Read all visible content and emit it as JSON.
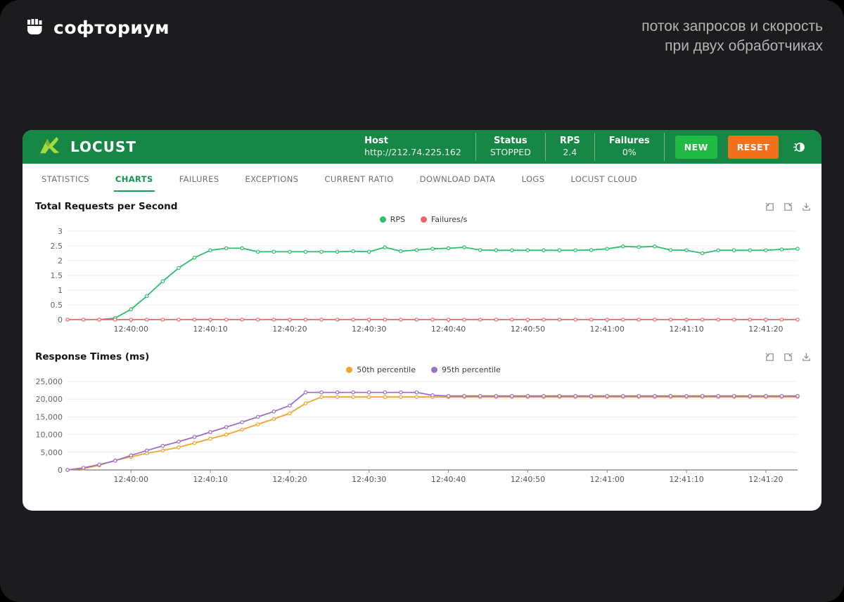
{
  "frame": {
    "brand": "софториум",
    "caption_line1": "поток запросов и скорость",
    "caption_line2": "при двух обработчиках"
  },
  "header": {
    "app_name": "LOCUST",
    "host_label": "Host",
    "host_value": "http://212.74.225.162",
    "status_label": "Status",
    "status_value": "STOPPED",
    "rps_label": "RPS",
    "rps_value": "2.4",
    "failures_label": "Failures",
    "failures_value": "0%",
    "new_button": "NEW",
    "reset_button": "RESET",
    "colors": {
      "header_bg": "#168744",
      "new_button": "#21ba45",
      "reset_button": "#f2711c",
      "logo_green": "#a6d93c"
    }
  },
  "tabs": [
    {
      "label": "STATISTICS",
      "active": false
    },
    {
      "label": "CHARTS",
      "active": true
    },
    {
      "label": "FAILURES",
      "active": false
    },
    {
      "label": "EXCEPTIONS",
      "active": false
    },
    {
      "label": "CURRENT RATIO",
      "active": false
    },
    {
      "label": "DOWNLOAD DATA",
      "active": false
    },
    {
      "label": "LOGS",
      "active": false
    },
    {
      "label": "LOCUST CLOUD",
      "active": false
    }
  ],
  "chart_data": [
    {
      "type": "line",
      "title": "Total Requests per Second",
      "xlabel": "",
      "ylabel": "",
      "x_start_time": "12:39:52",
      "t_range": [
        0,
        92
      ],
      "ylim": [
        0,
        3
      ],
      "grid": true,
      "legend_position": "top-center",
      "y_ticks": [
        {
          "v": 0,
          "label": "0"
        },
        {
          "v": 0.5,
          "label": "0.5"
        },
        {
          "v": 1,
          "label": "1"
        },
        {
          "v": 1.5,
          "label": "1.5"
        },
        {
          "v": 2,
          "label": "2"
        },
        {
          "v": 2.5,
          "label": "2.5"
        },
        {
          "v": 3,
          "label": "3"
        }
      ],
      "x_ticks": [
        {
          "t": 8,
          "label": "12:40:00"
        },
        {
          "t": 18,
          "label": "12:40:10"
        },
        {
          "t": 28,
          "label": "12:40:20"
        },
        {
          "t": 38,
          "label": "12:40:30"
        },
        {
          "t": 48,
          "label": "12:40:40"
        },
        {
          "t": 58,
          "label": "12:40:50"
        },
        {
          "t": 68,
          "label": "12:41:00"
        },
        {
          "t": 78,
          "label": "12:41:10"
        },
        {
          "t": 88,
          "label": "12:41:20"
        }
      ],
      "series": [
        {
          "name": "RPS",
          "color": "#2dbd6e",
          "points": [
            [
              4,
              0
            ],
            [
              6,
              0.05
            ],
            [
              8,
              0.35
            ],
            [
              10,
              0.8
            ],
            [
              12,
              1.3
            ],
            [
              14,
              1.75
            ],
            [
              16,
              2.1
            ],
            [
              18,
              2.35
            ],
            [
              20,
              2.42
            ],
            [
              22,
              2.42
            ],
            [
              24,
              2.3
            ],
            [
              26,
              2.3
            ],
            [
              28,
              2.3
            ],
            [
              30,
              2.3
            ],
            [
              32,
              2.3
            ],
            [
              34,
              2.3
            ],
            [
              36,
              2.32
            ],
            [
              38,
              2.3
            ],
            [
              40,
              2.45
            ],
            [
              42,
              2.32
            ],
            [
              44,
              2.36
            ],
            [
              46,
              2.4
            ],
            [
              48,
              2.42
            ],
            [
              50,
              2.45
            ],
            [
              52,
              2.36
            ],
            [
              54,
              2.35
            ],
            [
              56,
              2.35
            ],
            [
              58,
              2.35
            ],
            [
              60,
              2.35
            ],
            [
              62,
              2.35
            ],
            [
              64,
              2.35
            ],
            [
              66,
              2.36
            ],
            [
              68,
              2.4
            ],
            [
              70,
              2.48
            ],
            [
              72,
              2.46
            ],
            [
              74,
              2.48
            ],
            [
              76,
              2.36
            ],
            [
              78,
              2.35
            ],
            [
              80,
              2.25
            ],
            [
              82,
              2.35
            ],
            [
              84,
              2.35
            ],
            [
              86,
              2.35
            ],
            [
              88,
              2.35
            ],
            [
              90,
              2.38
            ],
            [
              92,
              2.4
            ]
          ]
        },
        {
          "name": "Failures/s",
          "color": "#ee6666",
          "points": [
            [
              0,
              0
            ],
            [
              2,
              0
            ],
            [
              4,
              0
            ],
            [
              6,
              0
            ],
            [
              8,
              0
            ],
            [
              10,
              0
            ],
            [
              12,
              0
            ],
            [
              14,
              0
            ],
            [
              16,
              0
            ],
            [
              18,
              0
            ],
            [
              20,
              0
            ],
            [
              22,
              0
            ],
            [
              24,
              0
            ],
            [
              26,
              0
            ],
            [
              28,
              0
            ],
            [
              30,
              0
            ],
            [
              32,
              0
            ],
            [
              34,
              0
            ],
            [
              36,
              0
            ],
            [
              38,
              0
            ],
            [
              40,
              0
            ],
            [
              42,
              0
            ],
            [
              44,
              0
            ],
            [
              46,
              0
            ],
            [
              48,
              0
            ],
            [
              50,
              0
            ],
            [
              52,
              0
            ],
            [
              54,
              0
            ],
            [
              56,
              0
            ],
            [
              58,
              0
            ],
            [
              60,
              0
            ],
            [
              62,
              0
            ],
            [
              64,
              0
            ],
            [
              66,
              0
            ],
            [
              68,
              0
            ],
            [
              70,
              0
            ],
            [
              72,
              0
            ],
            [
              74,
              0
            ],
            [
              76,
              0
            ],
            [
              78,
              0
            ],
            [
              80,
              0
            ],
            [
              82,
              0
            ],
            [
              84,
              0
            ],
            [
              86,
              0
            ],
            [
              88,
              0
            ],
            [
              90,
              0
            ],
            [
              92,
              0
            ]
          ]
        }
      ]
    },
    {
      "type": "line",
      "title": "Response Times (ms)",
      "xlabel": "",
      "ylabel": "",
      "x_start_time": "12:39:52",
      "t_range": [
        0,
        92
      ],
      "ylim": [
        0,
        25000
      ],
      "grid": true,
      "legend_position": "top-center",
      "y_ticks": [
        {
          "v": 0,
          "label": "0"
        },
        {
          "v": 5000,
          "label": "5,000"
        },
        {
          "v": 10000,
          "label": "10,000"
        },
        {
          "v": 15000,
          "label": "15,000"
        },
        {
          "v": 20000,
          "label": "20,000"
        },
        {
          "v": 25000,
          "label": "25,000"
        }
      ],
      "x_ticks": [
        {
          "t": 8,
          "label": "12:40:00"
        },
        {
          "t": 18,
          "label": "12:40:10"
        },
        {
          "t": 28,
          "label": "12:40:20"
        },
        {
          "t": 38,
          "label": "12:40:30"
        },
        {
          "t": 48,
          "label": "12:40:40"
        },
        {
          "t": 58,
          "label": "12:40:50"
        },
        {
          "t": 68,
          "label": "12:41:00"
        },
        {
          "t": 78,
          "label": "12:41:10"
        },
        {
          "t": 88,
          "label": "12:41:20"
        }
      ],
      "series": [
        {
          "name": "50th percentile",
          "color": "#f2a32c",
          "points": [
            [
              0,
              0
            ],
            [
              2,
              400
            ],
            [
              4,
              1300
            ],
            [
              6,
              2700
            ],
            [
              8,
              3700
            ],
            [
              10,
              4700
            ],
            [
              12,
              5500
            ],
            [
              14,
              6400
            ],
            [
              16,
              7600
            ],
            [
              18,
              8800
            ],
            [
              20,
              10000
            ],
            [
              22,
              11400
            ],
            [
              24,
              12900
            ],
            [
              26,
              14400
            ],
            [
              28,
              16000
            ],
            [
              30,
              18800
            ],
            [
              32,
              20600
            ],
            [
              34,
              20600
            ],
            [
              36,
              20600
            ],
            [
              38,
              20600
            ],
            [
              40,
              20600
            ],
            [
              42,
              20600
            ],
            [
              44,
              20600
            ],
            [
              46,
              20600
            ],
            [
              48,
              20600
            ],
            [
              50,
              20600
            ],
            [
              52,
              20600
            ],
            [
              54,
              20600
            ],
            [
              56,
              20600
            ],
            [
              58,
              20600
            ],
            [
              60,
              20600
            ],
            [
              62,
              20600
            ],
            [
              64,
              20600
            ],
            [
              66,
              20600
            ],
            [
              68,
              20600
            ],
            [
              70,
              20600
            ],
            [
              72,
              20600
            ],
            [
              74,
              20600
            ],
            [
              76,
              20600
            ],
            [
              78,
              20600
            ],
            [
              80,
              20600
            ],
            [
              82,
              20600
            ],
            [
              84,
              20600
            ],
            [
              86,
              20600
            ],
            [
              88,
              20600
            ],
            [
              90,
              20600
            ],
            [
              92,
              20600
            ]
          ]
        },
        {
          "name": "95th percentile",
          "color": "#9a6fc6",
          "points": [
            [
              0,
              0
            ],
            [
              2,
              600
            ],
            [
              4,
              1500
            ],
            [
              6,
              2600
            ],
            [
              8,
              4100
            ],
            [
              10,
              5500
            ],
            [
              12,
              6800
            ],
            [
              14,
              8000
            ],
            [
              16,
              9300
            ],
            [
              18,
              10700
            ],
            [
              20,
              12100
            ],
            [
              22,
              13500
            ],
            [
              24,
              15000
            ],
            [
              26,
              16500
            ],
            [
              28,
              18200
            ],
            [
              30,
              21900
            ],
            [
              32,
              21900
            ],
            [
              34,
              21900
            ],
            [
              36,
              21900
            ],
            [
              38,
              21900
            ],
            [
              40,
              21900
            ],
            [
              42,
              21900
            ],
            [
              44,
              21900
            ],
            [
              46,
              21100
            ],
            [
              48,
              20900
            ],
            [
              50,
              20900
            ],
            [
              52,
              20900
            ],
            [
              54,
              20900
            ],
            [
              56,
              20900
            ],
            [
              58,
              20900
            ],
            [
              60,
              20900
            ],
            [
              62,
              20900
            ],
            [
              64,
              20900
            ],
            [
              66,
              20900
            ],
            [
              68,
              20900
            ],
            [
              70,
              20900
            ],
            [
              72,
              20900
            ],
            [
              74,
              20900
            ],
            [
              76,
              20900
            ],
            [
              78,
              20900
            ],
            [
              80,
              20900
            ],
            [
              82,
              20900
            ],
            [
              84,
              20900
            ],
            [
              86,
              20900
            ],
            [
              88,
              20900
            ],
            [
              90,
              20900
            ],
            [
              92,
              20900
            ]
          ]
        }
      ]
    }
  ]
}
